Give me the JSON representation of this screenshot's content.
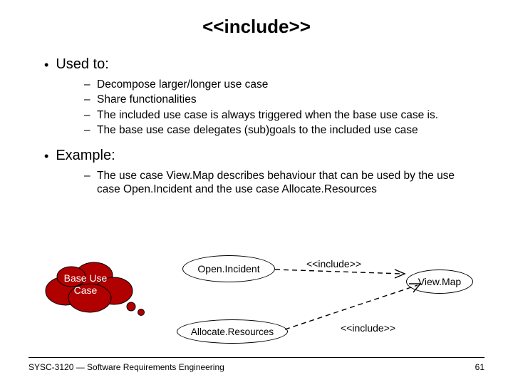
{
  "title": "<<include>>",
  "bullets": {
    "used_to": "Used to:",
    "items": [
      "Decompose larger/longer use case",
      "Share functionalities",
      "The included use case is always triggered when the base use case is.",
      "The base use case delegates (sub)goals to the included use case"
    ],
    "example": "Example:",
    "example_sub": "The use case View.Map describes behaviour that can be used by the use case Open.Incident and the use case Allocate.Resources"
  },
  "diagram": {
    "cloud_line1": "Base Use",
    "cloud_line2": "Case",
    "open_incident": "Open.Incident",
    "allocate": "Allocate.Resources",
    "viewmap": "View.Map",
    "include_label": "<<include>>"
  },
  "footer": {
    "left": "SYSC-3120 — Software Requirements Engineering",
    "right": "61"
  }
}
